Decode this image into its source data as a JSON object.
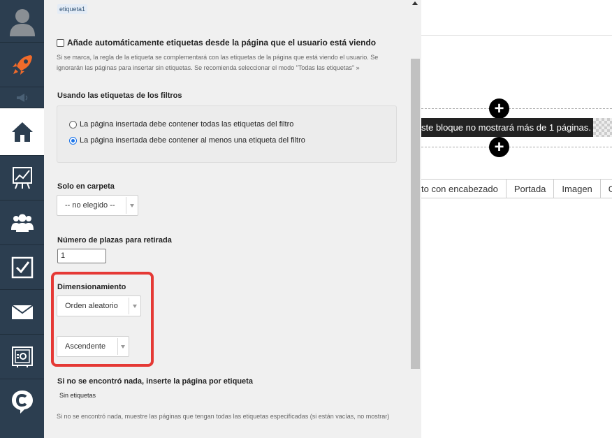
{
  "panel": {
    "tag_chip": "etiqueta1",
    "auto_tags_label": "Añade automáticamente etiquetas desde la página que el usuario está viendo",
    "auto_tags_help_line1": "Si se marca, la regla de la etiqueta se complementará con las etiquetas de la página que está viendo el usuario. Se",
    "auto_tags_help_line2": "ignorarán las páginas para insertar sin etiquetas. Se recomienda seleccionar el modo \"Todas las etiquetas\" »",
    "filter_tags_title": "Usando las etiquetas de los filtros",
    "radio_all_label": "La página insertada debe contener todas las etiquetas del filtro",
    "radio_any_label": "La página insertada debe contener al menos una etiqueta del filtro",
    "folder_title": "Solo en carpeta",
    "folder_value": "-- no elegido --",
    "places_title": "Número de plazas para retirada",
    "places_value": "1",
    "sizing_title": "Dimensionamiento",
    "order_value": "Orden aleatorio",
    "direction_value": "Ascendente",
    "fallback_title": "Si no se encontró nada, inserte la página por etiqueta",
    "fallback_value": "Sin etiquetas",
    "fallback_help": "Si no se encontró nada, muestre las páginas que tengan todas las etiquetas especificadas (si están vacías, no mostrar)"
  },
  "canvas": {
    "block_message": "ste bloque no mostrará más de 1 páginas.",
    "tabs": [
      "to con encabezado",
      "Portada",
      "Imagen",
      "Ga"
    ]
  },
  "colors": {
    "sidebar_bg": "#2c3e50",
    "accent_orange": "#f26b2a",
    "highlight_red": "#e53935"
  }
}
